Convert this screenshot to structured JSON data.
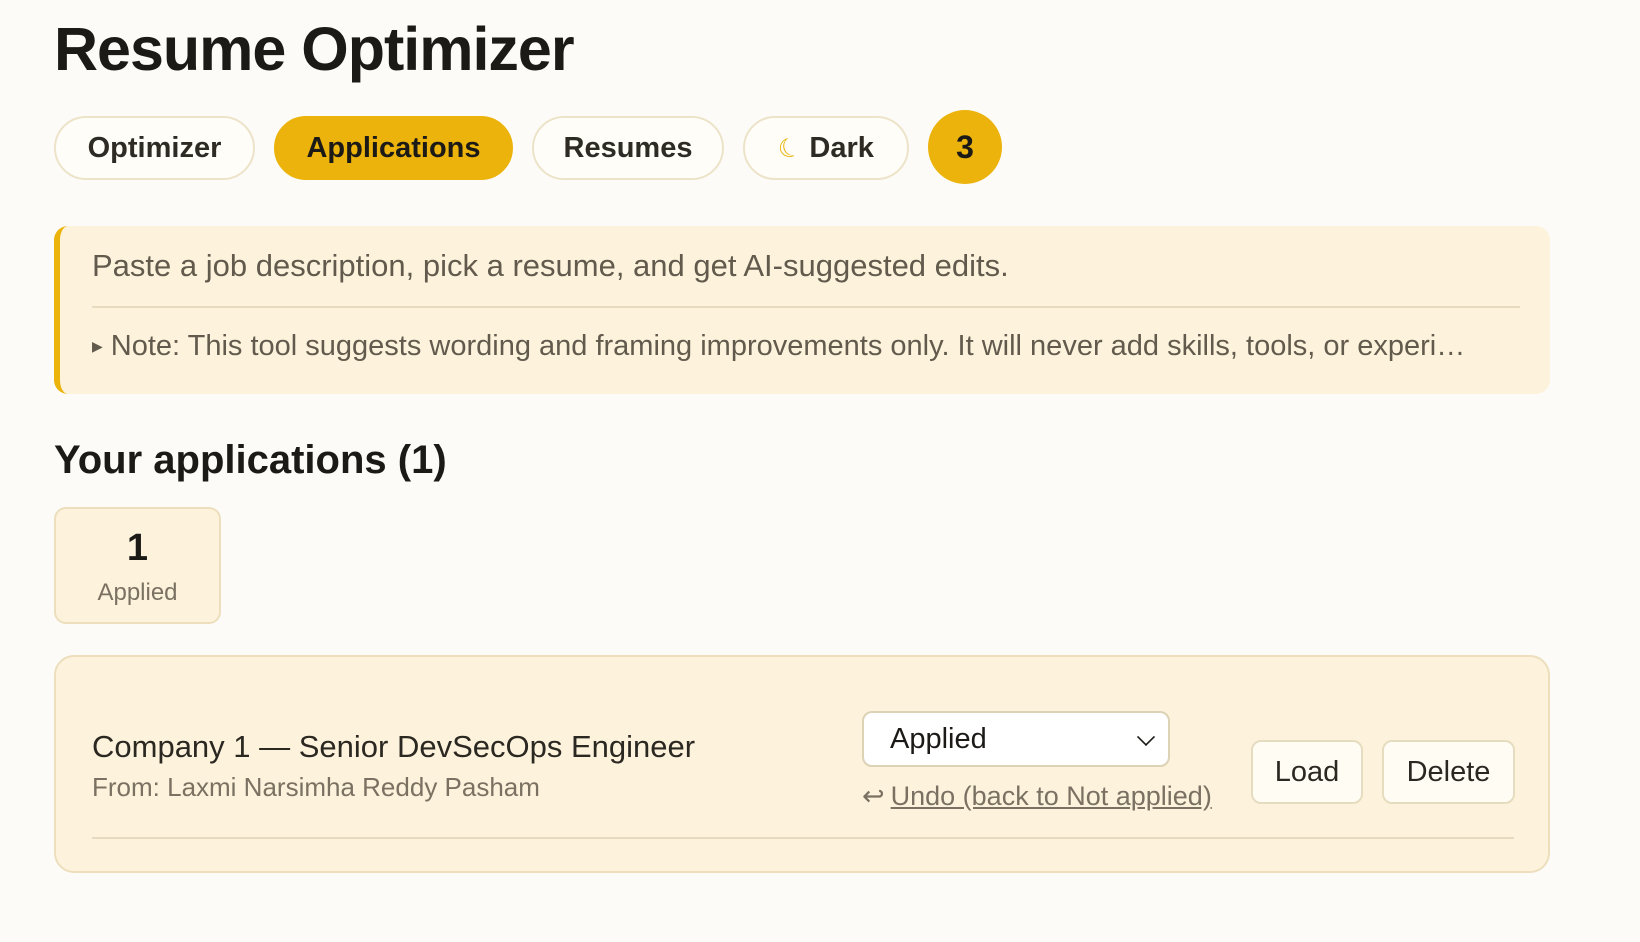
{
  "header": {
    "title": "Resume Optimizer"
  },
  "nav": {
    "tabs": [
      {
        "label": "Optimizer",
        "active": false
      },
      {
        "label": "Applications",
        "active": true
      },
      {
        "label": "Resumes",
        "active": false
      }
    ],
    "theme_toggle": {
      "icon": "moon-icon",
      "label": "Dark"
    },
    "badge_count": "3"
  },
  "info": {
    "intro": "Paste a job description, pick a resume, and get AI-suggested edits.",
    "note": "Note: This tool suggests wording and framing improvements only. It will never add skills, tools, or experi…"
  },
  "applications": {
    "heading": "Your applications (1)",
    "stats": [
      {
        "value": "1",
        "label": "Applied"
      }
    ],
    "items": [
      {
        "title": "Company 1 — Senior DevSecOps Engineer",
        "from": "From: Laxmi Narsimha Reddy Pasham",
        "status": "Applied",
        "undo_label": "Undo (back to Not applied)",
        "load_label": "Load",
        "delete_label": "Delete"
      }
    ]
  },
  "colors": {
    "accent": "#ebb30b",
    "panel_bg": "#fdf3dc",
    "page_bg": "#fdfbf7"
  }
}
